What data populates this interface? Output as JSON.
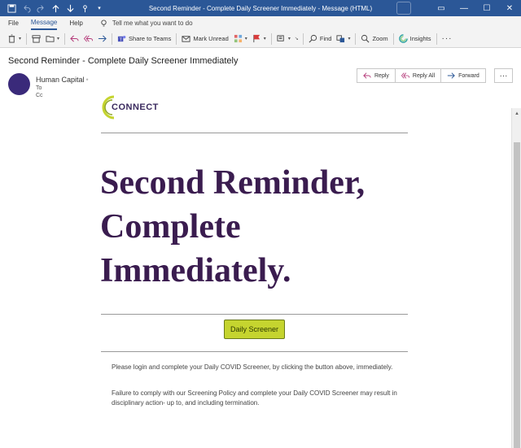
{
  "window": {
    "title": "Second Reminder - Complete Daily Screener Immediately  -  Message (HTML)",
    "controls": [
      "minimize",
      "restore",
      "close"
    ]
  },
  "menu": {
    "items": [
      "File",
      "Message",
      "Help"
    ],
    "active": "Message",
    "tell_me": "Tell me what you want to do"
  },
  "ribbon": {
    "share_teams": "Share to Teams",
    "mark_unread": "Mark Unread",
    "find": "Find",
    "zoom": "Zoom",
    "insights": "Insights"
  },
  "message": {
    "subject": "Second Reminder - Complete Daily Screener Immediately",
    "sender": "Human Capital",
    "to_label": "To",
    "cc_label": "Cc",
    "actions": [
      "Reply",
      "Reply All",
      "Forward"
    ]
  },
  "body": {
    "logo_text": "CONNECT",
    "headline": [
      "Second Reminder,",
      "Complete",
      "Immediately."
    ],
    "button": "Daily Screener",
    "paragraphs": [
      "Please login and complete your Daily COVID Screener, by clicking the button above, immediately.",
      "Failure to comply with our Screening Policy and complete your Daily COVID Screener may result in disciplinary action- up to, and including termination."
    ]
  },
  "colors": {
    "titlebar": "#2b5797",
    "headline": "#3a1c4f",
    "button": "#c5d42f",
    "avatar": "#3a2a7a"
  }
}
